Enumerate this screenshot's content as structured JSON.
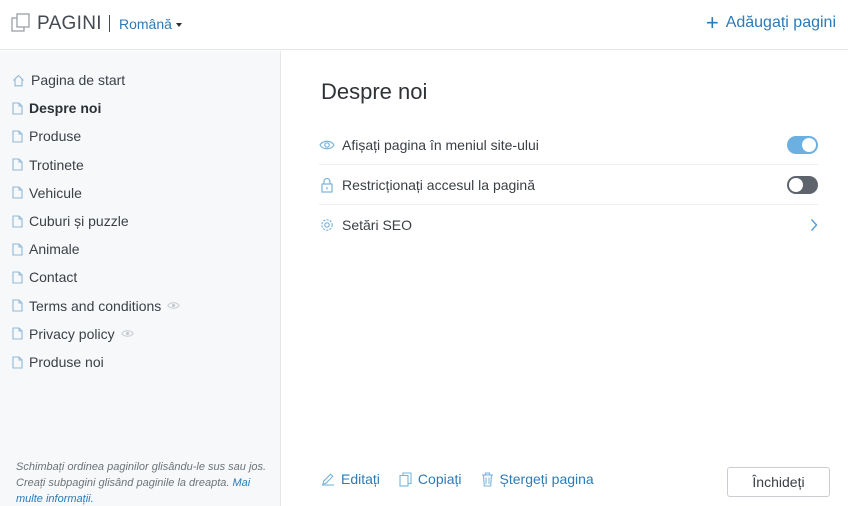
{
  "header": {
    "app_title": "PAGINI",
    "language": "Română",
    "add_pages_label": "Adăugați pagini"
  },
  "sidebar": {
    "items": [
      {
        "label": "Pagina de start",
        "icon": "home-icon",
        "active": false,
        "hidden": false
      },
      {
        "label": "Despre noi",
        "icon": "page-icon",
        "active": true,
        "hidden": false
      },
      {
        "label": "Produse",
        "icon": "page-icon",
        "active": false,
        "hidden": false
      },
      {
        "label": "Trotinete",
        "icon": "page-icon",
        "active": false,
        "hidden": false
      },
      {
        "label": "Vehicule",
        "icon": "page-icon",
        "active": false,
        "hidden": false
      },
      {
        "label": "Cuburi și puzzle",
        "icon": "page-icon",
        "active": false,
        "hidden": false
      },
      {
        "label": "Animale",
        "icon": "page-icon",
        "active": false,
        "hidden": false
      },
      {
        "label": "Contact",
        "icon": "page-icon",
        "active": false,
        "hidden": false
      },
      {
        "label": "Terms and conditions",
        "icon": "page-icon",
        "active": false,
        "hidden": true
      },
      {
        "label": "Privacy policy",
        "icon": "page-icon",
        "active": false,
        "hidden": true
      },
      {
        "label": "Produse noi",
        "icon": "page-icon",
        "active": false,
        "hidden": false
      }
    ],
    "hint_text": "Schimbați ordinea paginilor glisându-le sus sau jos. Creați subpagini glisând paginile la dreapta.",
    "hint_link": "Mai multe informații."
  },
  "main": {
    "title": "Despre noi",
    "settings": [
      {
        "label": "Afișați pagina în meniul site-ului",
        "icon": "eye-icon",
        "control": "toggle",
        "on": true
      },
      {
        "label": "Restricționați accesul la pagină",
        "icon": "lock-icon",
        "control": "toggle",
        "on": false
      },
      {
        "label": "Setări SEO",
        "icon": "gear-icon",
        "control": "chevron"
      }
    ],
    "actions": {
      "edit": "Editați",
      "copy": "Copiați",
      "delete": "Ștergeți pagina"
    },
    "close_button": "Închideți"
  },
  "colors": {
    "accent": "#2b7bb9",
    "toggle_on": "#6bb0e0",
    "toggle_off": "#5e646b",
    "sidebar_bg": "#f7f8fa"
  }
}
